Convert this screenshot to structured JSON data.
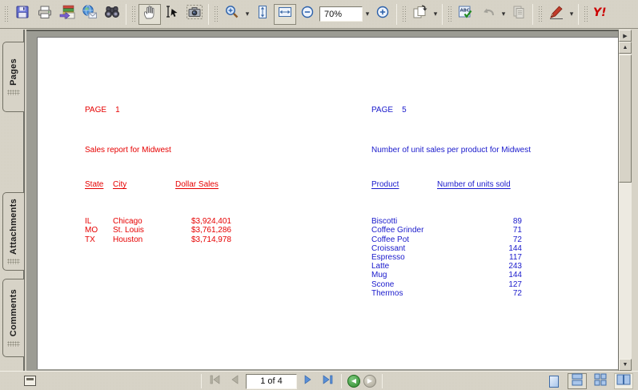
{
  "window": {
    "app_name": "pdf-viewer"
  },
  "toolbar": {
    "zoom_value": "70%",
    "icons": [
      "save",
      "print",
      "organizer",
      "email",
      "search-binoculars",
      "hand-tool",
      "select-tool",
      "snapshot",
      "zoom-in-tool",
      "fit-page",
      "fit-width",
      "zoom-out",
      "zoom-in",
      "create-pdf",
      "spellcheck-abc",
      "undo",
      "copy",
      "highlight-pen",
      "yahoo"
    ]
  },
  "sidebar": {
    "tabs": [
      {
        "label": "Pages"
      },
      {
        "label": "Attachments"
      },
      {
        "label": "Comments"
      }
    ]
  },
  "document": {
    "red_report": {
      "page_line": "PAGE    1",
      "title": "Sales report for Midwest",
      "color": "#e60000",
      "columns": [
        "State",
        "City",
        "Dollar Sales"
      ],
      "rows": [
        [
          "IL",
          "Chicago",
          "$3,924,401"
        ],
        [
          "MO",
          "St. Louis",
          "$3,761,286"
        ],
        [
          "TX",
          "Houston",
          "$3,714,978"
        ]
      ]
    },
    "blue_report": {
      "page_line": "PAGE    5",
      "title": "Number of unit sales per product for Midwest",
      "color": "#1a1acc",
      "columns": [
        "Product",
        "Number of units sold"
      ],
      "rows": [
        [
          "Biscotti",
          "89"
        ],
        [
          "Coffee Grinder",
          "71"
        ],
        [
          "Coffee Pot",
          "72"
        ],
        [
          "Croissant",
          "144"
        ],
        [
          "Espresso",
          "117"
        ],
        [
          "Latte",
          "243"
        ],
        [
          "Mug",
          "144"
        ],
        [
          "Scone",
          "127"
        ],
        [
          "Thermos",
          "72"
        ]
      ]
    }
  },
  "statusbar": {
    "page_indicator": "1 of 4",
    "icons": [
      "panel-splitter",
      "first-page",
      "previous-page",
      "next-page",
      "last-page",
      "previous-view",
      "next-view",
      "single-page-layout",
      "continuous-layout",
      "continuous-facing-layout",
      "facing-layout"
    ]
  }
}
